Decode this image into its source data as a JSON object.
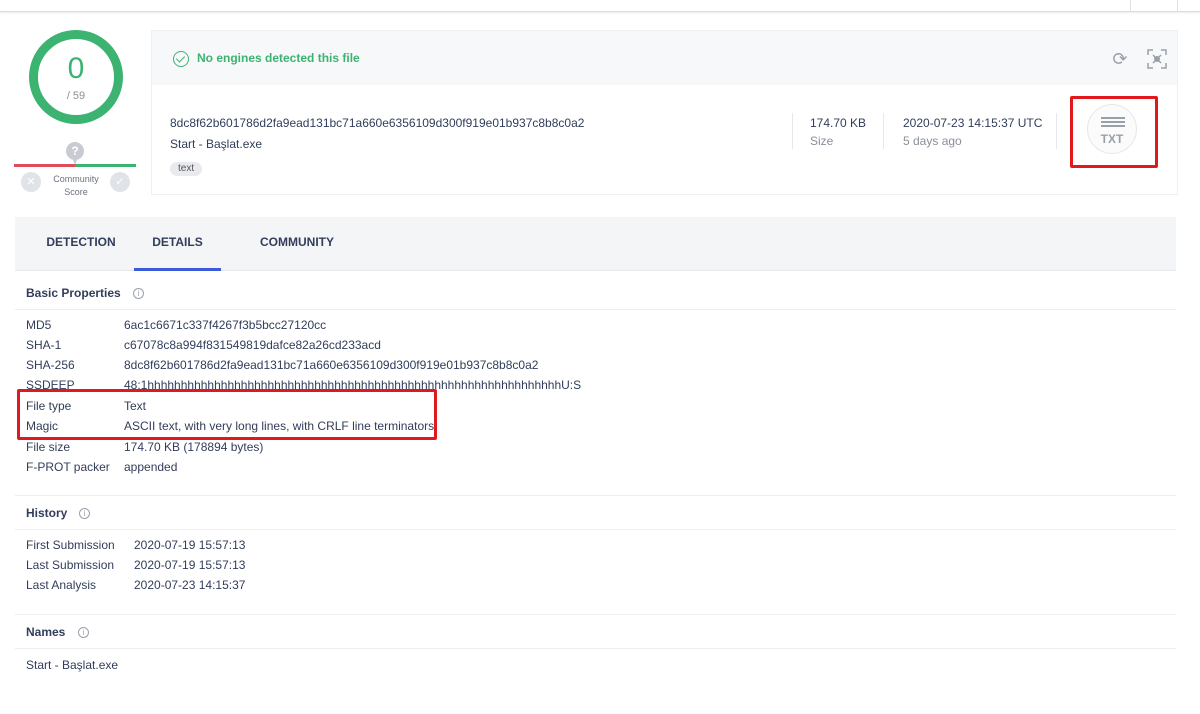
{
  "score": {
    "detections": "0",
    "total": "/ 59",
    "community_label": "Community Score",
    "question_mark": "?"
  },
  "summary": {
    "status_text": "No engines detected this file",
    "sha256": "8dc8f62b601786d2fa9ead131bc71a660e6356109d300f919e01b937c8b8c0a2",
    "file_name": "Start - Başlat.exe",
    "tag": "text",
    "size_value": "174.70 KB",
    "size_label": "Size",
    "date_value": "2020-07-23 14:15:37 UTC",
    "date_label": "5 days ago",
    "file_type_badge": "TXT"
  },
  "tabs": [
    {
      "label": "DETECTION",
      "active": false
    },
    {
      "label": "DETAILS",
      "active": true
    },
    {
      "label": "COMMUNITY",
      "active": false
    }
  ],
  "basic_properties": {
    "title": "Basic Properties",
    "rows": [
      {
        "key": "MD5",
        "value": "6ac1c6671c337f4267f3b5bcc27120cc"
      },
      {
        "key": "SHA-1",
        "value": "c67078c8a994f831549819dafce82a26cd233acd"
      },
      {
        "key": "SHA-256",
        "value": "8dc8f62b601786d2fa9ead131bc71a660e6356109d300f919e01b937c8b8c0a2"
      },
      {
        "key": "SSDEEP",
        "value": "48:1hhhhhhhhhhhhhhhhhhhhhhhhhhhhhhhhhhhhhhhhhhhhhhhhhhhhhhhhhhhhhhU:S"
      },
      {
        "key": "File type",
        "value": "Text"
      },
      {
        "key": "Magic",
        "value": "ASCII text, with very long lines, with CRLF line terminators"
      },
      {
        "key": "File size",
        "value": "174.70 KB (178894 bytes)"
      },
      {
        "key": "F-PROT packer",
        "value": "appended"
      }
    ]
  },
  "history": {
    "title": "History",
    "rows": [
      {
        "key": "First Submission",
        "value": "2020-07-19 15:57:13"
      },
      {
        "key": "Last Submission",
        "value": "2020-07-19 15:57:13"
      },
      {
        "key": "Last Analysis",
        "value": "2020-07-23 14:15:37"
      }
    ]
  },
  "names": {
    "title": "Names",
    "items": [
      "Start - Başlat.exe"
    ]
  },
  "colors": {
    "ok_green": "#3cb371",
    "highlight_red": "#e0191f",
    "tab_accent": "#3b5bdb"
  }
}
